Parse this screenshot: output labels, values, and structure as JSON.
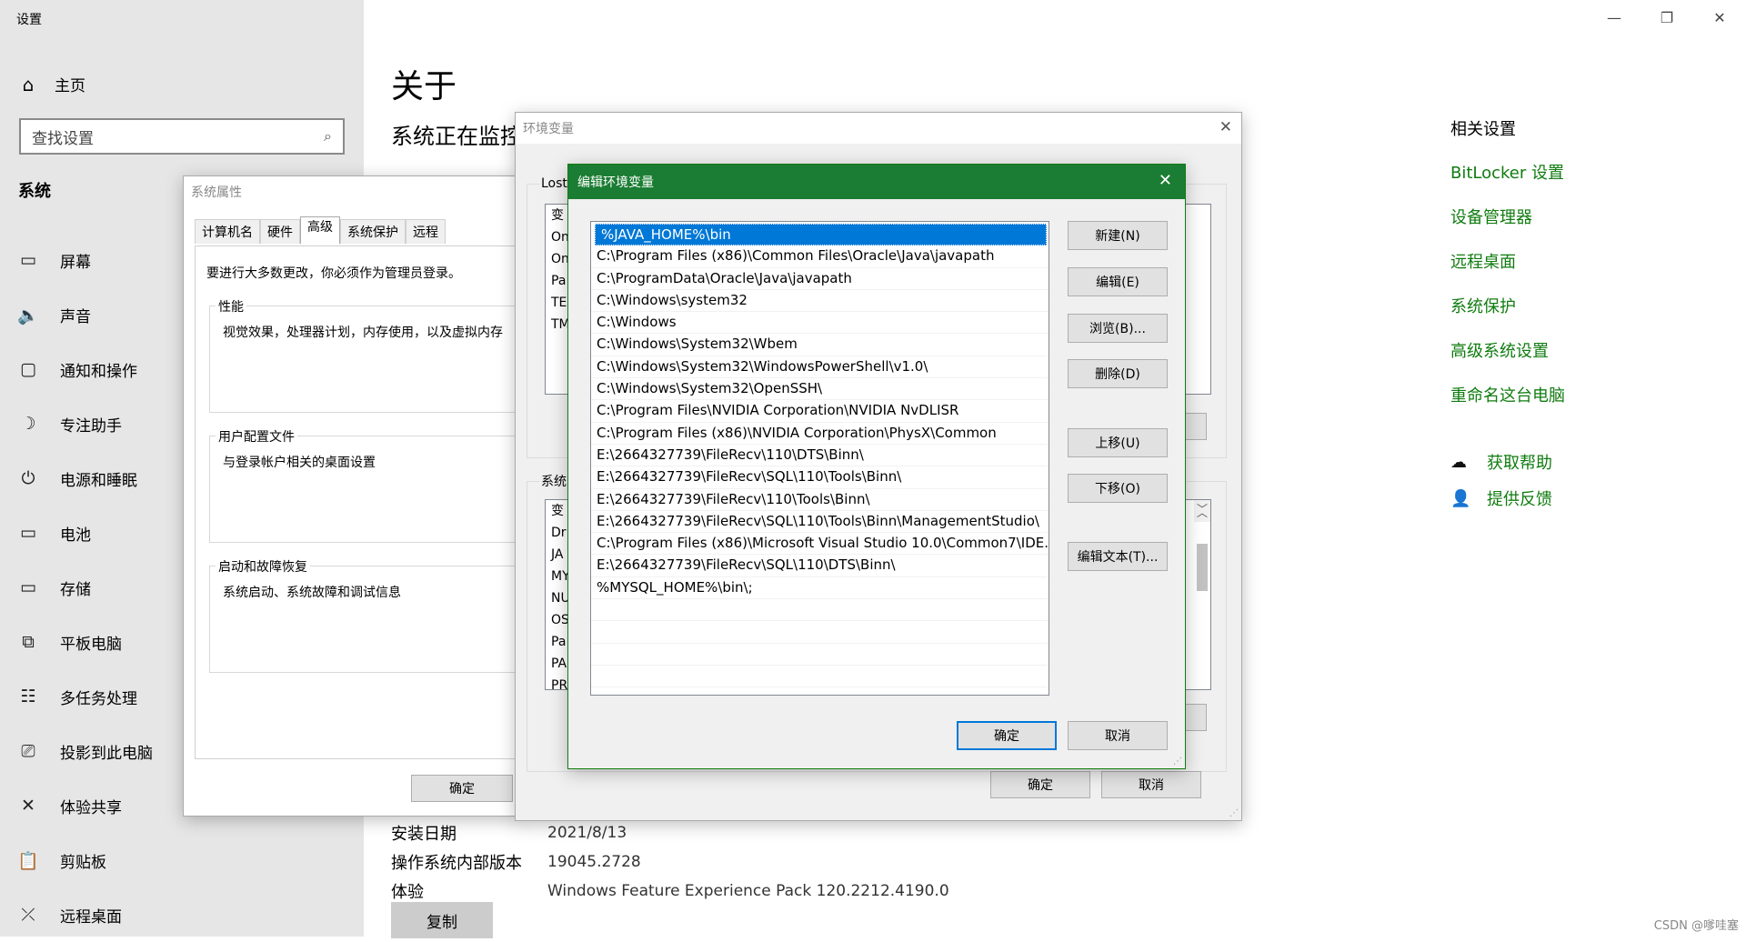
{
  "settings": {
    "app_title": "设置",
    "home": "主页",
    "search_placeholder": "查找设置",
    "section": "系统",
    "nav": [
      {
        "icon": "monitor-icon",
        "glyph": "▭",
        "label": "屏幕"
      },
      {
        "icon": "speaker-icon",
        "glyph": "🔈",
        "label": "声音"
      },
      {
        "icon": "notification-icon",
        "glyph": "▢",
        "label": "通知和操作"
      },
      {
        "icon": "moon-icon",
        "glyph": "☽",
        "label": "专注助手"
      },
      {
        "icon": "power-icon",
        "glyph": "⏻",
        "label": "电源和睡眠"
      },
      {
        "icon": "battery-icon",
        "glyph": "▭",
        "label": "电池"
      },
      {
        "icon": "storage-icon",
        "glyph": "▭",
        "label": "存储"
      },
      {
        "icon": "tablet-icon",
        "glyph": "⧉",
        "label": "平板电脑"
      },
      {
        "icon": "multitask-icon",
        "glyph": "☷",
        "label": "多任务处理"
      },
      {
        "icon": "project-icon",
        "glyph": "⎚",
        "label": "投影到此电脑"
      },
      {
        "icon": "share-icon",
        "glyph": "✕",
        "label": "体验共享"
      },
      {
        "icon": "clipboard-icon",
        "glyph": "📋",
        "label": "剪贴板"
      },
      {
        "icon": "remote-icon",
        "glyph": "⤫",
        "label": "远程桌面"
      }
    ],
    "page_title": "关于",
    "monitor_text": "系统正在监控",
    "info_rows": [
      {
        "key": "安装日期",
        "value": "2021/8/13"
      },
      {
        "key": "操作系统内部版本",
        "value": "19045.2728"
      },
      {
        "key": "体验",
        "value": "Windows Feature Experience Pack 120.2212.4190.0"
      }
    ],
    "copy_button": "复制",
    "related_title": "相关设置",
    "related_links": [
      "BitLocker 设置",
      "设备管理器",
      "远程桌面",
      "系统保护",
      "高级系统设置",
      "重命名这台电脑"
    ],
    "help": [
      {
        "icon": "help-icon",
        "glyph": "☁",
        "label": "获取帮助"
      },
      {
        "icon": "feedback-icon",
        "glyph": "👤",
        "label": "提供反馈"
      }
    ],
    "window_controls": {
      "minimize": "—",
      "restore": "❐",
      "close": "✕"
    }
  },
  "system_properties": {
    "title": "系统属性",
    "tabs": [
      "计算机名",
      "硬件",
      "高级",
      "系统保护",
      "远程"
    ],
    "active_tab": "高级",
    "admin_note": "要进行大多数更改，你必须作为管理员登录。",
    "groups": [
      {
        "legend": "性能",
        "desc": "视觉效果，处理器计划，内存使用，以及虚拟内存"
      },
      {
        "legend": "用户配置文件",
        "desc": "与登录帐户相关的桌面设置"
      },
      {
        "legend": "启动和故障恢复",
        "desc": "系统启动、系统故障和调试信息"
      }
    ],
    "ok": "确定"
  },
  "env_vars": {
    "title": "环境变量",
    "user_section_label": "Lost",
    "user_rows": [
      "变",
      "On",
      "On",
      "Pa",
      "TE",
      "TM"
    ],
    "system_section_label": "系统",
    "system_rows": [
      "变",
      "Dr",
      "JA",
      "MY",
      "NU",
      "OS",
      "Pa",
      "PA",
      "PR"
    ],
    "ok": "确定",
    "cancel": "取消"
  },
  "edit_env": {
    "title": "编辑环境变量",
    "close": "✕",
    "paths": [
      "%JAVA_HOME%\\bin",
      "C:\\Program Files (x86)\\Common Files\\Oracle\\Java\\javapath",
      "C:\\ProgramData\\Oracle\\Java\\javapath",
      "C:\\Windows\\system32",
      "C:\\Windows",
      "C:\\Windows\\System32\\Wbem",
      "C:\\Windows\\System32\\WindowsPowerShell\\v1.0\\",
      "C:\\Windows\\System32\\OpenSSH\\",
      "C:\\Program Files\\NVIDIA Corporation\\NVIDIA NvDLISR",
      "C:\\Program Files (x86)\\NVIDIA Corporation\\PhysX\\Common",
      "E:\\2664327739\\FileRecv\\110\\DTS\\Binn\\",
      "E:\\2664327739\\FileRecv\\SQL\\110\\Tools\\Binn\\",
      "E:\\2664327739\\FileRecv\\110\\Tools\\Binn\\",
      "E:\\2664327739\\FileRecv\\SQL\\110\\Tools\\Binn\\ManagementStudio\\",
      "C:\\Program Files (x86)\\Microsoft Visual Studio 10.0\\Common7\\IDE...",
      "E:\\2664327739\\FileRecv\\SQL\\110\\DTS\\Binn\\",
      "%MYSQL_HOME%\\bin\\;"
    ],
    "selected_index": 0,
    "buttons": {
      "new": "新建(N)",
      "edit": "编辑(E)",
      "browse": "浏览(B)...",
      "delete": "删除(D)",
      "up": "上移(U)",
      "down": "下移(O)",
      "edit_text": "编辑文本(T)..."
    },
    "ok": "确定",
    "cancel": "取消"
  },
  "watermark": "CSDN @嗲哇塞",
  "colors": {
    "accent_green": "#107c10",
    "title_green": "#1b7d33",
    "selection_blue": "#0078d7"
  }
}
